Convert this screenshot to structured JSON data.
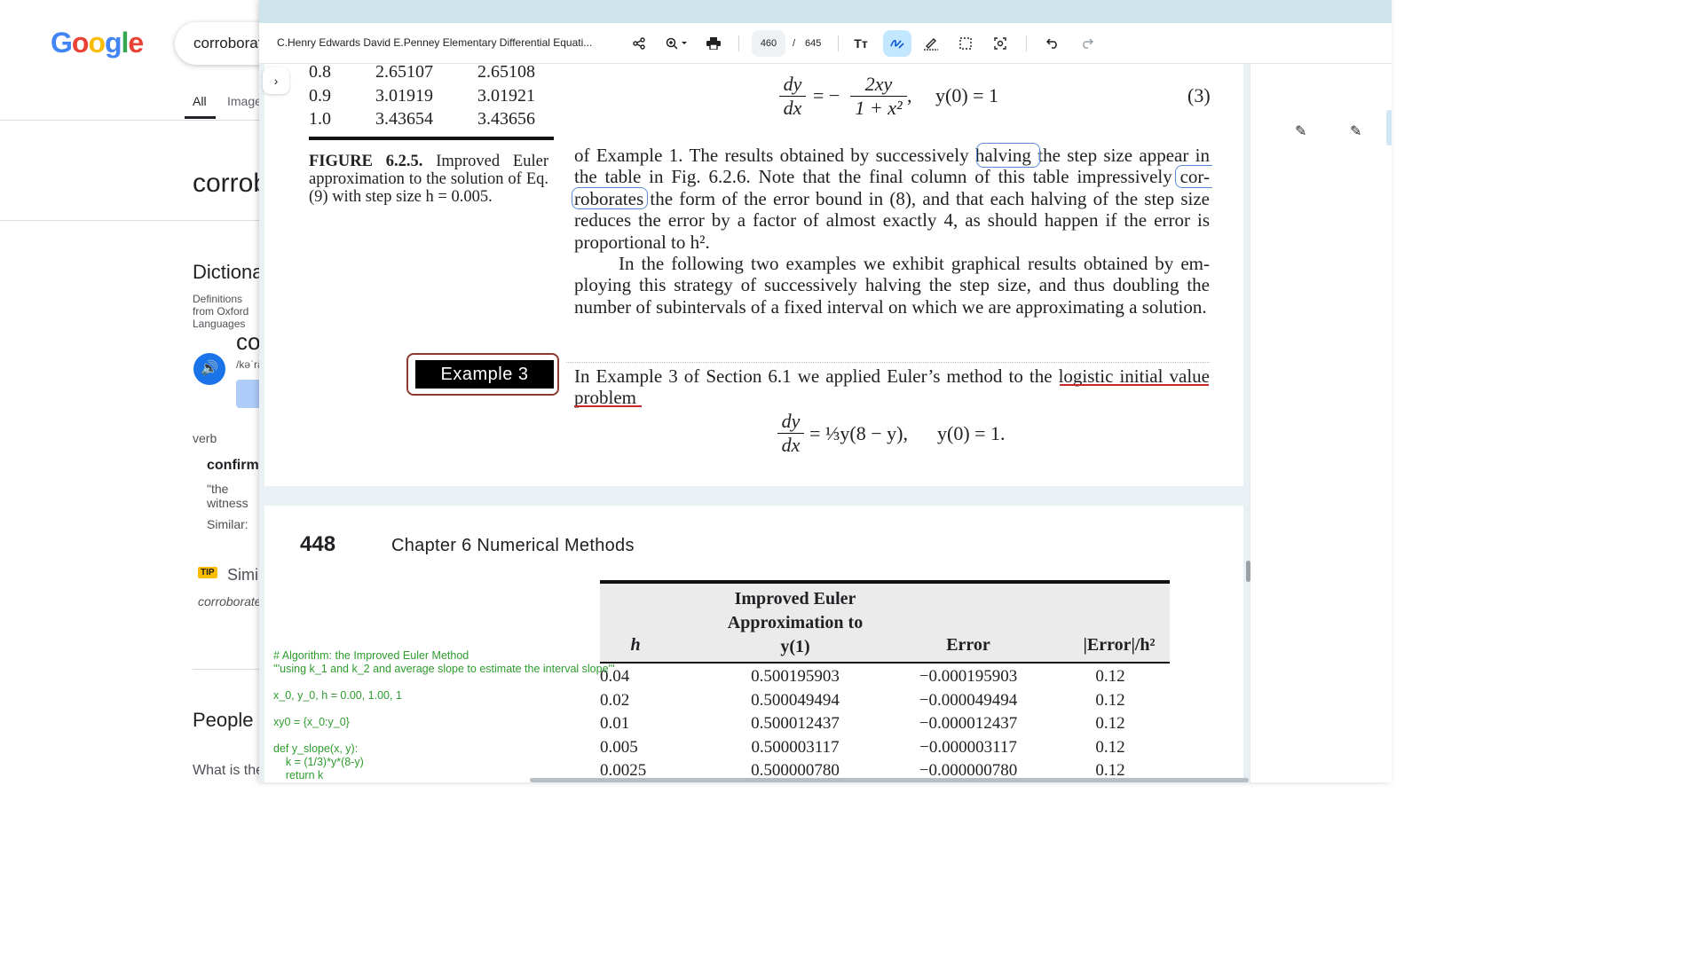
{
  "google": {
    "logo": "Google",
    "search_value": "corroborate",
    "tabs": [
      "All",
      "Images"
    ],
    "word_heading": "corroborate",
    "dictionary_heading": "Dictionary",
    "dictionary_sub": "Definitions from Oxford Languages",
    "headword": "cor",
    "phonetic": "/kəˈrä",
    "pos": "verb",
    "definition_lead": "confirm",
    "example_quote": "\"the witness",
    "similar_label": "Similar:",
    "tip_badge": "TIP",
    "tip_text": "Similar",
    "corroborate_line": "corroborate",
    "people_heading": "People",
    "what_question": "What is the"
  },
  "viewer": {
    "doc_title": "C.Henry Edwards David E.Penney Elementary Differential Equati...",
    "current_page": "460",
    "page_separator": "/",
    "total_pages": "645",
    "icons": {
      "share": "share-icon",
      "zoom": "zoom-in-icon",
      "print": "print-icon",
      "text": "text-icon",
      "highlight": "highlighter-icon",
      "draw": "draw-icon",
      "select": "select-icon",
      "scan": "scan-icon",
      "undo": "undo-icon",
      "redo": "redo-icon"
    }
  },
  "page1": {
    "table_rows": [
      {
        "x": "0.8",
        "a": "2.65107",
        "b": "2.65108"
      },
      {
        "x": "0.9",
        "a": "3.01919",
        "b": "3.01921"
      },
      {
        "x": "1.0",
        "a": "3.43654",
        "b": "3.43656"
      }
    ],
    "figure_label": "FIGURE 6.2.5.",
    "figure_caption": " Improved Euler approximation to the solution of Eq. (9) with step size h = 0.005.",
    "eq3_lhs_num": "dy",
    "eq3_lhs_den": "dx",
    "eq3_eq": "= −",
    "eq3_rhs_num": "2xy",
    "eq3_rhs_den": "1 + x²",
    "eq3_comma": ",",
    "eq3_ic": "y(0) = 1",
    "eq3_number": "(3)",
    "para1_a": "of Example 1. The results obtained by successively ",
    "para1_halving": "halving",
    "para1_b": " the step size appear in the table in Fig. 6.2.6. Note that the final column of this table impressively ",
    "para1_cor": "cor-",
    "para1_c": " ",
    "para1_roborates": "roborates",
    "para1_d": " the form of the error bound in (8), and that each halving of the step size reduces the error by a factor of almost exactly 4, as should happen if the error is proportional to h².",
    "para2": "In the following two examples we exhibit graphical results obtained by em­ploying this strategy of successively halving the step size, and thus doubling the number of subintervals of a fixed interval on which we are approximating a solu­tion.",
    "example_label": "Example 3",
    "para3": "In Example 3 of Section 6.1 we applied Euler’s method to the logistic initial value problem",
    "eq4_lhs_num": "dy",
    "eq4_lhs_den": "dx",
    "eq4_rhs": "= ⅓y(8 − y),",
    "eq4_ic": "y(0) = 1."
  },
  "page2": {
    "page_number": "448",
    "chapter": "Chapter 6  Numerical Methods",
    "headers": [
      "h",
      "Improved Euler Approximation to y(1)",
      "Error",
      "|Error|/h²"
    ],
    "rows": [
      [
        "0.04",
        "0.500195903",
        "−0.000195903",
        "0.12"
      ],
      [
        "0.02",
        "0.500049494",
        "−0.000049494",
        "0.12"
      ],
      [
        "0.01",
        "0.500012437",
        "−0.000012437",
        "0.12"
      ],
      [
        "0.005",
        "0.500003117",
        "−0.000003117",
        "0.12"
      ],
      [
        "0.0025",
        "0.500000780",
        "−0.000000780",
        "0.12"
      ]
    ],
    "code": "# Algorithm: the Improved Euler Method\n'''using k_1 and k_2 and average slope to estimate the interval slope'''\n\nx_0, y_0, h = 0.00, 1.00, 1\n\nxy0 = {x_0:y_0}\n\ndef y_slope(x, y):\n    k = (1/3)*y*(8-y)\n    return k"
  },
  "colors": {
    "toolbar_bg": "#ffffff",
    "top_strip": "#cde4ea",
    "highlight_active": "#c2e7ff",
    "circle_annotation": "#5b8dd6",
    "red_underline": "#c62828",
    "example_border": "#8b3a32",
    "code_green": "#2e9b2e"
  }
}
